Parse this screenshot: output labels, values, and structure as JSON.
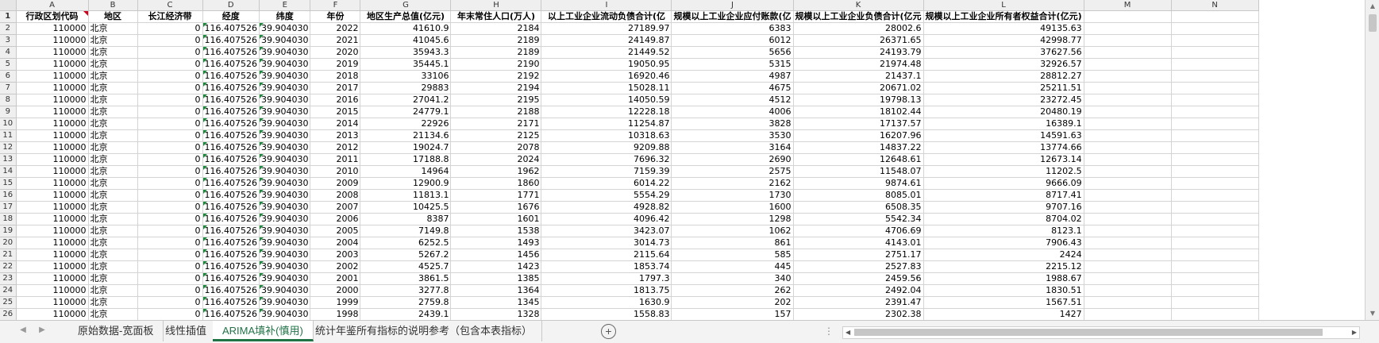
{
  "columns": [
    "A",
    "B",
    "C",
    "D",
    "E",
    "F",
    "G",
    "H",
    "I",
    "J",
    "K",
    "L",
    "M",
    "N"
  ],
  "header_row": [
    "行政区划代码",
    "地区",
    "长江经济带",
    "经度",
    "纬度",
    "年份",
    "地区生产总值(亿元)",
    "年末常住人口(万人)",
    "以上工业企业流动负债合计(亿",
    "规模以上工业企业应付账款(亿",
    "规模以上工业企业负债合计(亿元",
    "规模以上工业企业所有者权益合计(亿元)",
    "",
    ""
  ],
  "rows": [
    [
      "110000",
      "北京",
      "0",
      "116.407526",
      "39.904030",
      "2022",
      "41610.9",
      "2184",
      "27189.97",
      "6383",
      "28002.6",
      "49135.63"
    ],
    [
      "110000",
      "北京",
      "0",
      "116.407526",
      "39.904030",
      "2021",
      "41045.6",
      "2189",
      "24149.87",
      "6012",
      "26371.65",
      "42998.77"
    ],
    [
      "110000",
      "北京",
      "0",
      "116.407526",
      "39.904030",
      "2020",
      "35943.3",
      "2189",
      "21449.52",
      "5656",
      "24193.79",
      "37627.56"
    ],
    [
      "110000",
      "北京",
      "0",
      "116.407526",
      "39.904030",
      "2019",
      "35445.1",
      "2190",
      "19050.95",
      "5315",
      "21974.48",
      "32926.57"
    ],
    [
      "110000",
      "北京",
      "0",
      "116.407526",
      "39.904030",
      "2018",
      "33106",
      "2192",
      "16920.46",
      "4987",
      "21437.1",
      "28812.27"
    ],
    [
      "110000",
      "北京",
      "0",
      "116.407526",
      "39.904030",
      "2017",
      "29883",
      "2194",
      "15028.11",
      "4675",
      "20671.02",
      "25211.51"
    ],
    [
      "110000",
      "北京",
      "0",
      "116.407526",
      "39.904030",
      "2016",
      "27041.2",
      "2195",
      "14050.59",
      "4512",
      "19798.13",
      "23272.45"
    ],
    [
      "110000",
      "北京",
      "0",
      "116.407526",
      "39.904030",
      "2015",
      "24779.1",
      "2188",
      "12228.18",
      "4006",
      "18102.44",
      "20480.19"
    ],
    [
      "110000",
      "北京",
      "0",
      "116.407526",
      "39.904030",
      "2014",
      "22926",
      "2171",
      "11254.87",
      "3828",
      "17137.57",
      "16389.1"
    ],
    [
      "110000",
      "北京",
      "0",
      "116.407526",
      "39.904030",
      "2013",
      "21134.6",
      "2125",
      "10318.63",
      "3530",
      "16207.96",
      "14591.63"
    ],
    [
      "110000",
      "北京",
      "0",
      "116.407526",
      "39.904030",
      "2012",
      "19024.7",
      "2078",
      "9209.88",
      "3164",
      "14837.22",
      "13774.66"
    ],
    [
      "110000",
      "北京",
      "0",
      "116.407526",
      "39.904030",
      "2011",
      "17188.8",
      "2024",
      "7696.32",
      "2690",
      "12648.61",
      "12673.14"
    ],
    [
      "110000",
      "北京",
      "0",
      "116.407526",
      "39.904030",
      "2010",
      "14964",
      "1962",
      "7159.39",
      "2575",
      "11548.07",
      "11202.5"
    ],
    [
      "110000",
      "北京",
      "0",
      "116.407526",
      "39.904030",
      "2009",
      "12900.9",
      "1860",
      "6014.22",
      "2162",
      "9874.61",
      "9666.09"
    ],
    [
      "110000",
      "北京",
      "0",
      "116.407526",
      "39.904030",
      "2008",
      "11813.1",
      "1771",
      "5554.29",
      "1730",
      "8085.01",
      "8717.41"
    ],
    [
      "110000",
      "北京",
      "0",
      "116.407526",
      "39.904030",
      "2007",
      "10425.5",
      "1676",
      "4928.82",
      "1600",
      "6508.35",
      "9707.16"
    ],
    [
      "110000",
      "北京",
      "0",
      "116.407526",
      "39.904030",
      "2006",
      "8387",
      "1601",
      "4096.42",
      "1298",
      "5542.34",
      "8704.02"
    ],
    [
      "110000",
      "北京",
      "0",
      "116.407526",
      "39.904030",
      "2005",
      "7149.8",
      "1538",
      "3423.07",
      "1062",
      "4706.69",
      "8123.1"
    ],
    [
      "110000",
      "北京",
      "0",
      "116.407526",
      "39.904030",
      "2004",
      "6252.5",
      "1493",
      "3014.73",
      "861",
      "4143.01",
      "7906.43"
    ],
    [
      "110000",
      "北京",
      "0",
      "116.407526",
      "39.904030",
      "2003",
      "5267.2",
      "1456",
      "2115.64",
      "585",
      "2751.17",
      "2424"
    ],
    [
      "110000",
      "北京",
      "0",
      "116.407526",
      "39.904030",
      "2002",
      "4525.7",
      "1423",
      "1853.74",
      "445",
      "2527.83",
      "2215.12"
    ],
    [
      "110000",
      "北京",
      "0",
      "116.407526",
      "39.904030",
      "2001",
      "3861.5",
      "1385",
      "1797.3",
      "340",
      "2459.56",
      "1988.67"
    ],
    [
      "110000",
      "北京",
      "0",
      "116.407526",
      "39.904030",
      "2000",
      "3277.8",
      "1364",
      "1813.75",
      "262",
      "2492.04",
      "1830.51"
    ],
    [
      "110000",
      "北京",
      "0",
      "116.407526",
      "39.904030",
      "1999",
      "2759.8",
      "1345",
      "1630.9",
      "202",
      "2391.47",
      "1567.51"
    ],
    [
      "110000",
      "北京",
      "0",
      "116.407526",
      "39.904030",
      "1998",
      "2439.1",
      "1328",
      "1558.83",
      "157",
      "2302.38",
      "1427"
    ]
  ],
  "sheet_tabs": [
    "原始数据-宽面板",
    "线性插值",
    "ARIMA填补(慎用)",
    "统计年鉴所有指标的说明参考（包含本表指标）"
  ],
  "active_tab_index": 2,
  "icons": {
    "add_sheet": "plus-circle-icon",
    "more": "ellipsis-icon"
  },
  "colors": {
    "accent": "#217346",
    "comment_marker": "#d0021b",
    "number_as_text_marker": "#1a8a3a"
  }
}
